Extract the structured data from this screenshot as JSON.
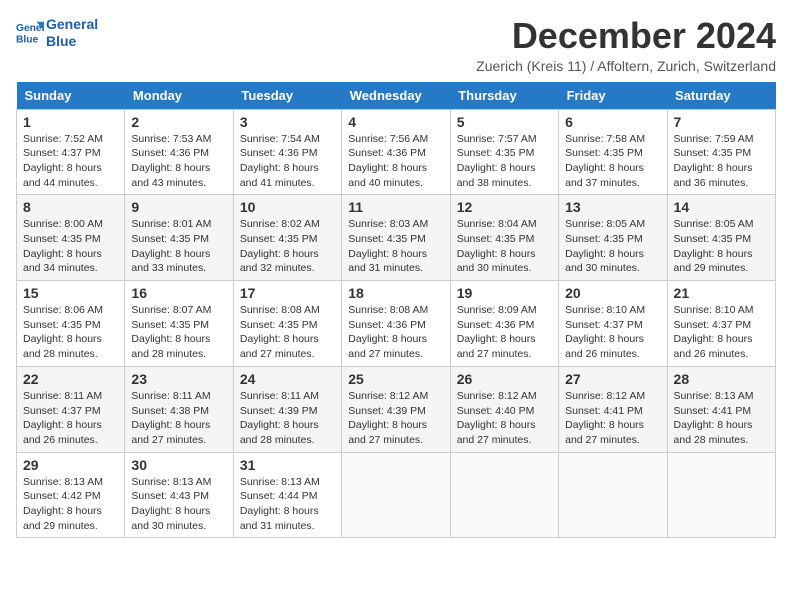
{
  "header": {
    "logo_line1": "General",
    "logo_line2": "Blue",
    "month_title": "December 2024",
    "location": "Zuerich (Kreis 11) / Affoltern, Zurich, Switzerland"
  },
  "days_of_week": [
    "Sunday",
    "Monday",
    "Tuesday",
    "Wednesday",
    "Thursday",
    "Friday",
    "Saturday"
  ],
  "weeks": [
    [
      {
        "day": "1",
        "sunrise": "Sunrise: 7:52 AM",
        "sunset": "Sunset: 4:37 PM",
        "daylight": "Daylight: 8 hours and 44 minutes."
      },
      {
        "day": "2",
        "sunrise": "Sunrise: 7:53 AM",
        "sunset": "Sunset: 4:36 PM",
        "daylight": "Daylight: 8 hours and 43 minutes."
      },
      {
        "day": "3",
        "sunrise": "Sunrise: 7:54 AM",
        "sunset": "Sunset: 4:36 PM",
        "daylight": "Daylight: 8 hours and 41 minutes."
      },
      {
        "day": "4",
        "sunrise": "Sunrise: 7:56 AM",
        "sunset": "Sunset: 4:36 PM",
        "daylight": "Daylight: 8 hours and 40 minutes."
      },
      {
        "day": "5",
        "sunrise": "Sunrise: 7:57 AM",
        "sunset": "Sunset: 4:35 PM",
        "daylight": "Daylight: 8 hours and 38 minutes."
      },
      {
        "day": "6",
        "sunrise": "Sunrise: 7:58 AM",
        "sunset": "Sunset: 4:35 PM",
        "daylight": "Daylight: 8 hours and 37 minutes."
      },
      {
        "day": "7",
        "sunrise": "Sunrise: 7:59 AM",
        "sunset": "Sunset: 4:35 PM",
        "daylight": "Daylight: 8 hours and 36 minutes."
      }
    ],
    [
      {
        "day": "8",
        "sunrise": "Sunrise: 8:00 AM",
        "sunset": "Sunset: 4:35 PM",
        "daylight": "Daylight: 8 hours and 34 minutes."
      },
      {
        "day": "9",
        "sunrise": "Sunrise: 8:01 AM",
        "sunset": "Sunset: 4:35 PM",
        "daylight": "Daylight: 8 hours and 33 minutes."
      },
      {
        "day": "10",
        "sunrise": "Sunrise: 8:02 AM",
        "sunset": "Sunset: 4:35 PM",
        "daylight": "Daylight: 8 hours and 32 minutes."
      },
      {
        "day": "11",
        "sunrise": "Sunrise: 8:03 AM",
        "sunset": "Sunset: 4:35 PM",
        "daylight": "Daylight: 8 hours and 31 minutes."
      },
      {
        "day": "12",
        "sunrise": "Sunrise: 8:04 AM",
        "sunset": "Sunset: 4:35 PM",
        "daylight": "Daylight: 8 hours and 30 minutes."
      },
      {
        "day": "13",
        "sunrise": "Sunrise: 8:05 AM",
        "sunset": "Sunset: 4:35 PM",
        "daylight": "Daylight: 8 hours and 30 minutes."
      },
      {
        "day": "14",
        "sunrise": "Sunrise: 8:05 AM",
        "sunset": "Sunset: 4:35 PM",
        "daylight": "Daylight: 8 hours and 29 minutes."
      }
    ],
    [
      {
        "day": "15",
        "sunrise": "Sunrise: 8:06 AM",
        "sunset": "Sunset: 4:35 PM",
        "daylight": "Daylight: 8 hours and 28 minutes."
      },
      {
        "day": "16",
        "sunrise": "Sunrise: 8:07 AM",
        "sunset": "Sunset: 4:35 PM",
        "daylight": "Daylight: 8 hours and 28 minutes."
      },
      {
        "day": "17",
        "sunrise": "Sunrise: 8:08 AM",
        "sunset": "Sunset: 4:35 PM",
        "daylight": "Daylight: 8 hours and 27 minutes."
      },
      {
        "day": "18",
        "sunrise": "Sunrise: 8:08 AM",
        "sunset": "Sunset: 4:36 PM",
        "daylight": "Daylight: 8 hours and 27 minutes."
      },
      {
        "day": "19",
        "sunrise": "Sunrise: 8:09 AM",
        "sunset": "Sunset: 4:36 PM",
        "daylight": "Daylight: 8 hours and 27 minutes."
      },
      {
        "day": "20",
        "sunrise": "Sunrise: 8:10 AM",
        "sunset": "Sunset: 4:37 PM",
        "daylight": "Daylight: 8 hours and 26 minutes."
      },
      {
        "day": "21",
        "sunrise": "Sunrise: 8:10 AM",
        "sunset": "Sunset: 4:37 PM",
        "daylight": "Daylight: 8 hours and 26 minutes."
      }
    ],
    [
      {
        "day": "22",
        "sunrise": "Sunrise: 8:11 AM",
        "sunset": "Sunset: 4:37 PM",
        "daylight": "Daylight: 8 hours and 26 minutes."
      },
      {
        "day": "23",
        "sunrise": "Sunrise: 8:11 AM",
        "sunset": "Sunset: 4:38 PM",
        "daylight": "Daylight: 8 hours and 27 minutes."
      },
      {
        "day": "24",
        "sunrise": "Sunrise: 8:11 AM",
        "sunset": "Sunset: 4:39 PM",
        "daylight": "Daylight: 8 hours and 28 minutes."
      },
      {
        "day": "25",
        "sunrise": "Sunrise: 8:12 AM",
        "sunset": "Sunset: 4:39 PM",
        "daylight": "Daylight: 8 hours and 27 minutes."
      },
      {
        "day": "26",
        "sunrise": "Sunrise: 8:12 AM",
        "sunset": "Sunset: 4:40 PM",
        "daylight": "Daylight: 8 hours and 27 minutes."
      },
      {
        "day": "27",
        "sunrise": "Sunrise: 8:12 AM",
        "sunset": "Sunset: 4:41 PM",
        "daylight": "Daylight: 8 hours and 27 minutes."
      },
      {
        "day": "28",
        "sunrise": "Sunrise: 8:13 AM",
        "sunset": "Sunset: 4:41 PM",
        "daylight": "Daylight: 8 hours and 28 minutes."
      }
    ],
    [
      {
        "day": "29",
        "sunrise": "Sunrise: 8:13 AM",
        "sunset": "Sunset: 4:42 PM",
        "daylight": "Daylight: 8 hours and 29 minutes."
      },
      {
        "day": "30",
        "sunrise": "Sunrise: 8:13 AM",
        "sunset": "Sunset: 4:43 PM",
        "daylight": "Daylight: 8 hours and 30 minutes."
      },
      {
        "day": "31",
        "sunrise": "Sunrise: 8:13 AM",
        "sunset": "Sunset: 4:44 PM",
        "daylight": "Daylight: 8 hours and 31 minutes."
      },
      null,
      null,
      null,
      null
    ]
  ]
}
